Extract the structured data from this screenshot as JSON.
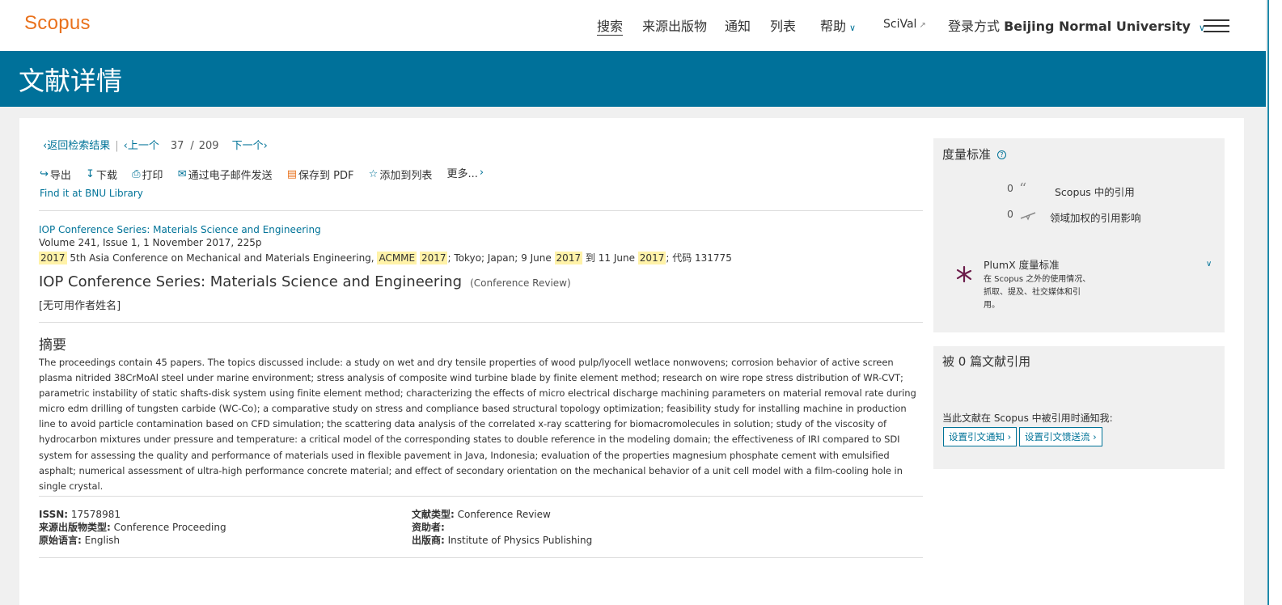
{
  "header": {
    "logo": "Scopus",
    "nav": {
      "search": "搜索",
      "sources": "来源出版物",
      "alerts": "通知",
      "lists": "列表",
      "help": "帮助",
      "scival": "SciVal",
      "login_prefix": "登录方式",
      "institution": "Beijing Normal University"
    }
  },
  "banner": {
    "title": "文献详情"
  },
  "pager": {
    "back": "返回检索结果",
    "prev": "上一个",
    "current": "37",
    "divider": "/",
    "total": "209",
    "next": "下一个"
  },
  "toolbar": {
    "export": "导出",
    "download": "下载",
    "print": "打印",
    "email": "通过电子邮件发送",
    "save_pdf": "保存到 PDF",
    "add_list": "添加到列表",
    "more": "更多..."
  },
  "find_library": "Find it at BNU Library",
  "source": {
    "journal_link": "IOP Conference Series: Materials Science and Engineering",
    "volume_line": "Volume 241, Issue 1, 1 November 2017, 225p",
    "conf": {
      "year1": "2017",
      "text1": "5th Asia Conference on Mechanical and Materials Engineering,",
      "acronym": "ACMME",
      "year2": "2017",
      "text2": "; Tokyo; Japan; 9 June",
      "year3": "2017",
      "text3": "到 11 June",
      "year4": "2017",
      "text4": "; 代码 131775"
    }
  },
  "document": {
    "title": "IOP Conference Series: Materials Science and Engineering",
    "type": "(Conference Review)",
    "authors": "[无可用作者姓名]"
  },
  "abstract": {
    "heading": "摘要",
    "text": "The proceedings contain 45 papers. The topics discussed include: a study on wet and dry tensile properties of wood pulp/lyocell wetlace nonwovens; corrosion behavior of active screen plasma nitrided 38CrMoAl steel under marine environment; stress analysis of composite wind turbine blade by finite element method; research on wire rope stress distribution of WR-CVT; parametric instability of static shafts-disk system using finite element method; characterizing the effects of micro electrical discharge machining parameters on material removal rate during micro edm drilling of tungsten carbide (WC-Co); a comparative study on stress and compliance based structural topology optimization; feasibility study for installing machine in production line to avoid particle contamination based on CFD simulation; the scattering data analysis of the correlated x-ray scattering for biomacromolecules in solution; study of the viscosity of hydrocarbon mixtures under pressure and temperature: a critical model of the corresponding states to double reference in the modeling domain; the effectiveness of IRI compared to SDI system for assessing the quality and performance of materials used in flexible pavement in Java, Indonesia; evaluation of the properties magnesium phosphate cement with emulsified asphalt; numerical assessment of ultra-high performance concrete material; and effect of secondary orientation on the mechanical behavior of a unit cell model with a film-cooling hole in single crystal."
  },
  "meta": {
    "issn_label": "ISSN:",
    "issn": "17578981",
    "source_type_label": "来源出版物类型:",
    "source_type": "Conference Proceeding",
    "language_label": "原始语言:",
    "language": "English",
    "doc_type_label": "文献类型:",
    "doc_type": "Conference Review",
    "sponsor_label": "资助者:",
    "publisher_label": "出版商:",
    "publisher": "Institute of Physics Publishing"
  },
  "metrics": {
    "title": "度量标准",
    "citations_count": "0",
    "citations_label": "Scopus 中的引用",
    "fwci_count": "0",
    "fwci_label": "领域加权的引用影响",
    "plumx_title": "PlumX 度量标准",
    "plumx_desc": [
      "在 Scopus 之外的使用情况、",
      "抓取、提及、社交媒体和引",
      "用。"
    ]
  },
  "cited_by": {
    "title": "被 0 篇文献引用",
    "notify_text": "当此文献在 Scopus 中被引用时通知我:",
    "alert_button": "设置引文通知",
    "feed_button": "设置引文馈送流"
  },
  "colors": {
    "accent": "#007398",
    "brand": "#e9711c",
    "highlight": "#fff2a8"
  }
}
